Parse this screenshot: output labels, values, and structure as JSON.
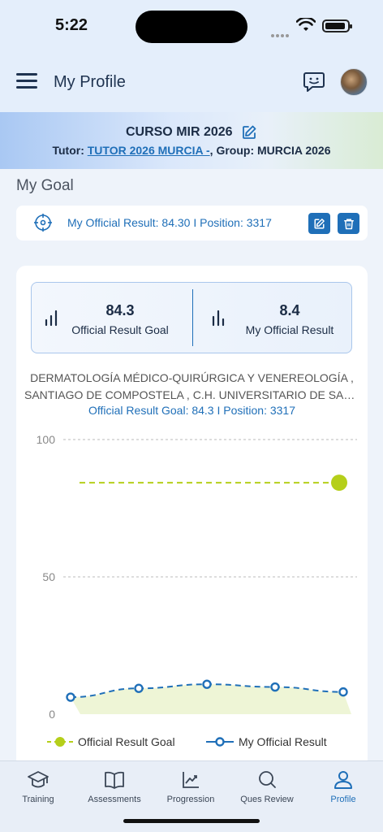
{
  "status_bar": {
    "time": "5:22"
  },
  "header": {
    "title": "My Profile"
  },
  "banner": {
    "course": "CURSO MIR 2026",
    "tutor_label": "Tutor: ",
    "tutor_name": "TUTOR 2026 MURCIA -",
    "group_label": ", Group: ",
    "group_name": "MURCIA 2026"
  },
  "goal_section": {
    "title": "My Goal",
    "goal_text": "My Official Result: 84.30 I Position: 3317"
  },
  "stats": {
    "goal_value": "84.3",
    "goal_label": "Official Result Goal",
    "result_value": "8.4",
    "result_label": "My Official Result"
  },
  "specialty": {
    "line1": "DERMATOLOGÍA MÉDICO-QUIRÚRGICA Y VENEREOLOGÍA ,",
    "line2": "SANTIAGO DE COMPOSTELA , C.H. UNIVERSITARIO DE SAN...",
    "goal_summary": "Official Result Goal: 84.3 I Position: 3317"
  },
  "chart_data": {
    "type": "line",
    "ylim": [
      0,
      100
    ],
    "yticks": [
      "100",
      "50",
      "0"
    ],
    "series": [
      {
        "name": "Official Result Goal",
        "color": "#b5cf1a",
        "values": [
          84.3,
          84.3,
          84.3,
          84.3,
          84.3,
          84.3
        ],
        "style": "dashed",
        "marker_last_only": true
      },
      {
        "name": "My Official Result",
        "color": "#1f6fb8",
        "values": [
          6.2,
          9.4,
          10.9,
          9.9,
          8.1
        ],
        "style": "dashed",
        "area_fill": "#eef5d6"
      }
    ],
    "grid": true,
    "legend_position": "bottom"
  },
  "tabbar": {
    "items": [
      {
        "label": "Training",
        "icon": "graduation-cap-icon"
      },
      {
        "label": "Assessments",
        "icon": "book-icon"
      },
      {
        "label": "Progression",
        "icon": "chart-icon"
      },
      {
        "label": "Ques Review",
        "icon": "search-icon"
      },
      {
        "label": "Profile",
        "icon": "user-icon",
        "active": true
      }
    ]
  },
  "colors": {
    "accent": "#1f6fb8",
    "goal_line": "#b5cf1a",
    "text_dark": "#1b2c45"
  }
}
